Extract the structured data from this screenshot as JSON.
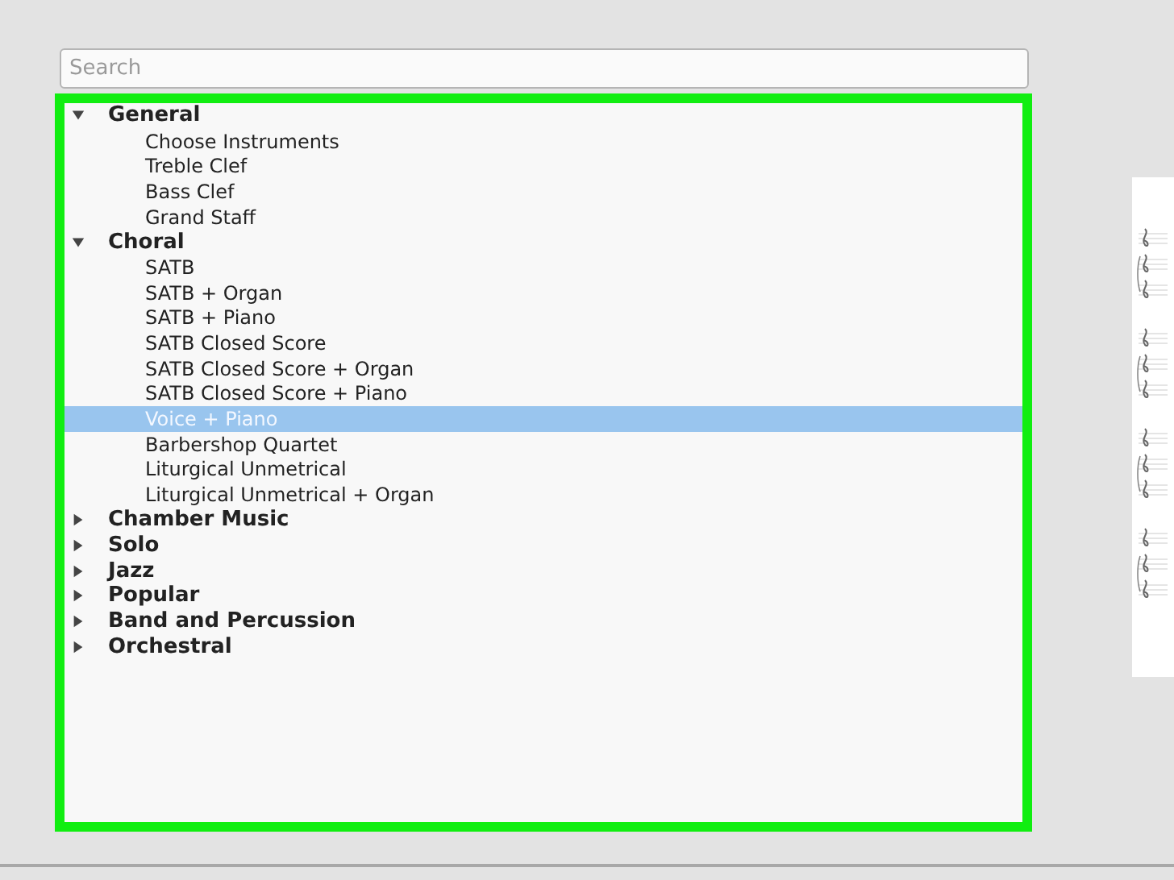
{
  "search": {
    "placeholder": "Search"
  },
  "templates": [
    {
      "label": "General",
      "expanded": true,
      "children": [
        {
          "label": "Choose Instruments",
          "selected": false
        },
        {
          "label": "Treble Clef",
          "selected": false
        },
        {
          "label": "Bass Clef",
          "selected": false
        },
        {
          "label": "Grand Staff",
          "selected": false
        }
      ]
    },
    {
      "label": "Choral",
      "expanded": true,
      "children": [
        {
          "label": "SATB",
          "selected": false
        },
        {
          "label": "SATB + Organ",
          "selected": false
        },
        {
          "label": "SATB + Piano",
          "selected": false
        },
        {
          "label": "SATB Closed Score",
          "selected": false
        },
        {
          "label": "SATB Closed Score + Organ",
          "selected": false
        },
        {
          "label": "SATB Closed Score + Piano",
          "selected": false
        },
        {
          "label": "Voice + Piano",
          "selected": true
        },
        {
          "label": "Barbershop Quartet",
          "selected": false
        },
        {
          "label": "Liturgical Unmetrical",
          "selected": false
        },
        {
          "label": "Liturgical Unmetrical + Organ",
          "selected": false
        }
      ]
    },
    {
      "label": "Chamber Music",
      "expanded": false
    },
    {
      "label": "Solo",
      "expanded": false
    },
    {
      "label": "Jazz",
      "expanded": false
    },
    {
      "label": "Popular",
      "expanded": false
    },
    {
      "label": "Band and Percussion",
      "expanded": false
    },
    {
      "label": "Orchestral",
      "expanded": false
    }
  ]
}
